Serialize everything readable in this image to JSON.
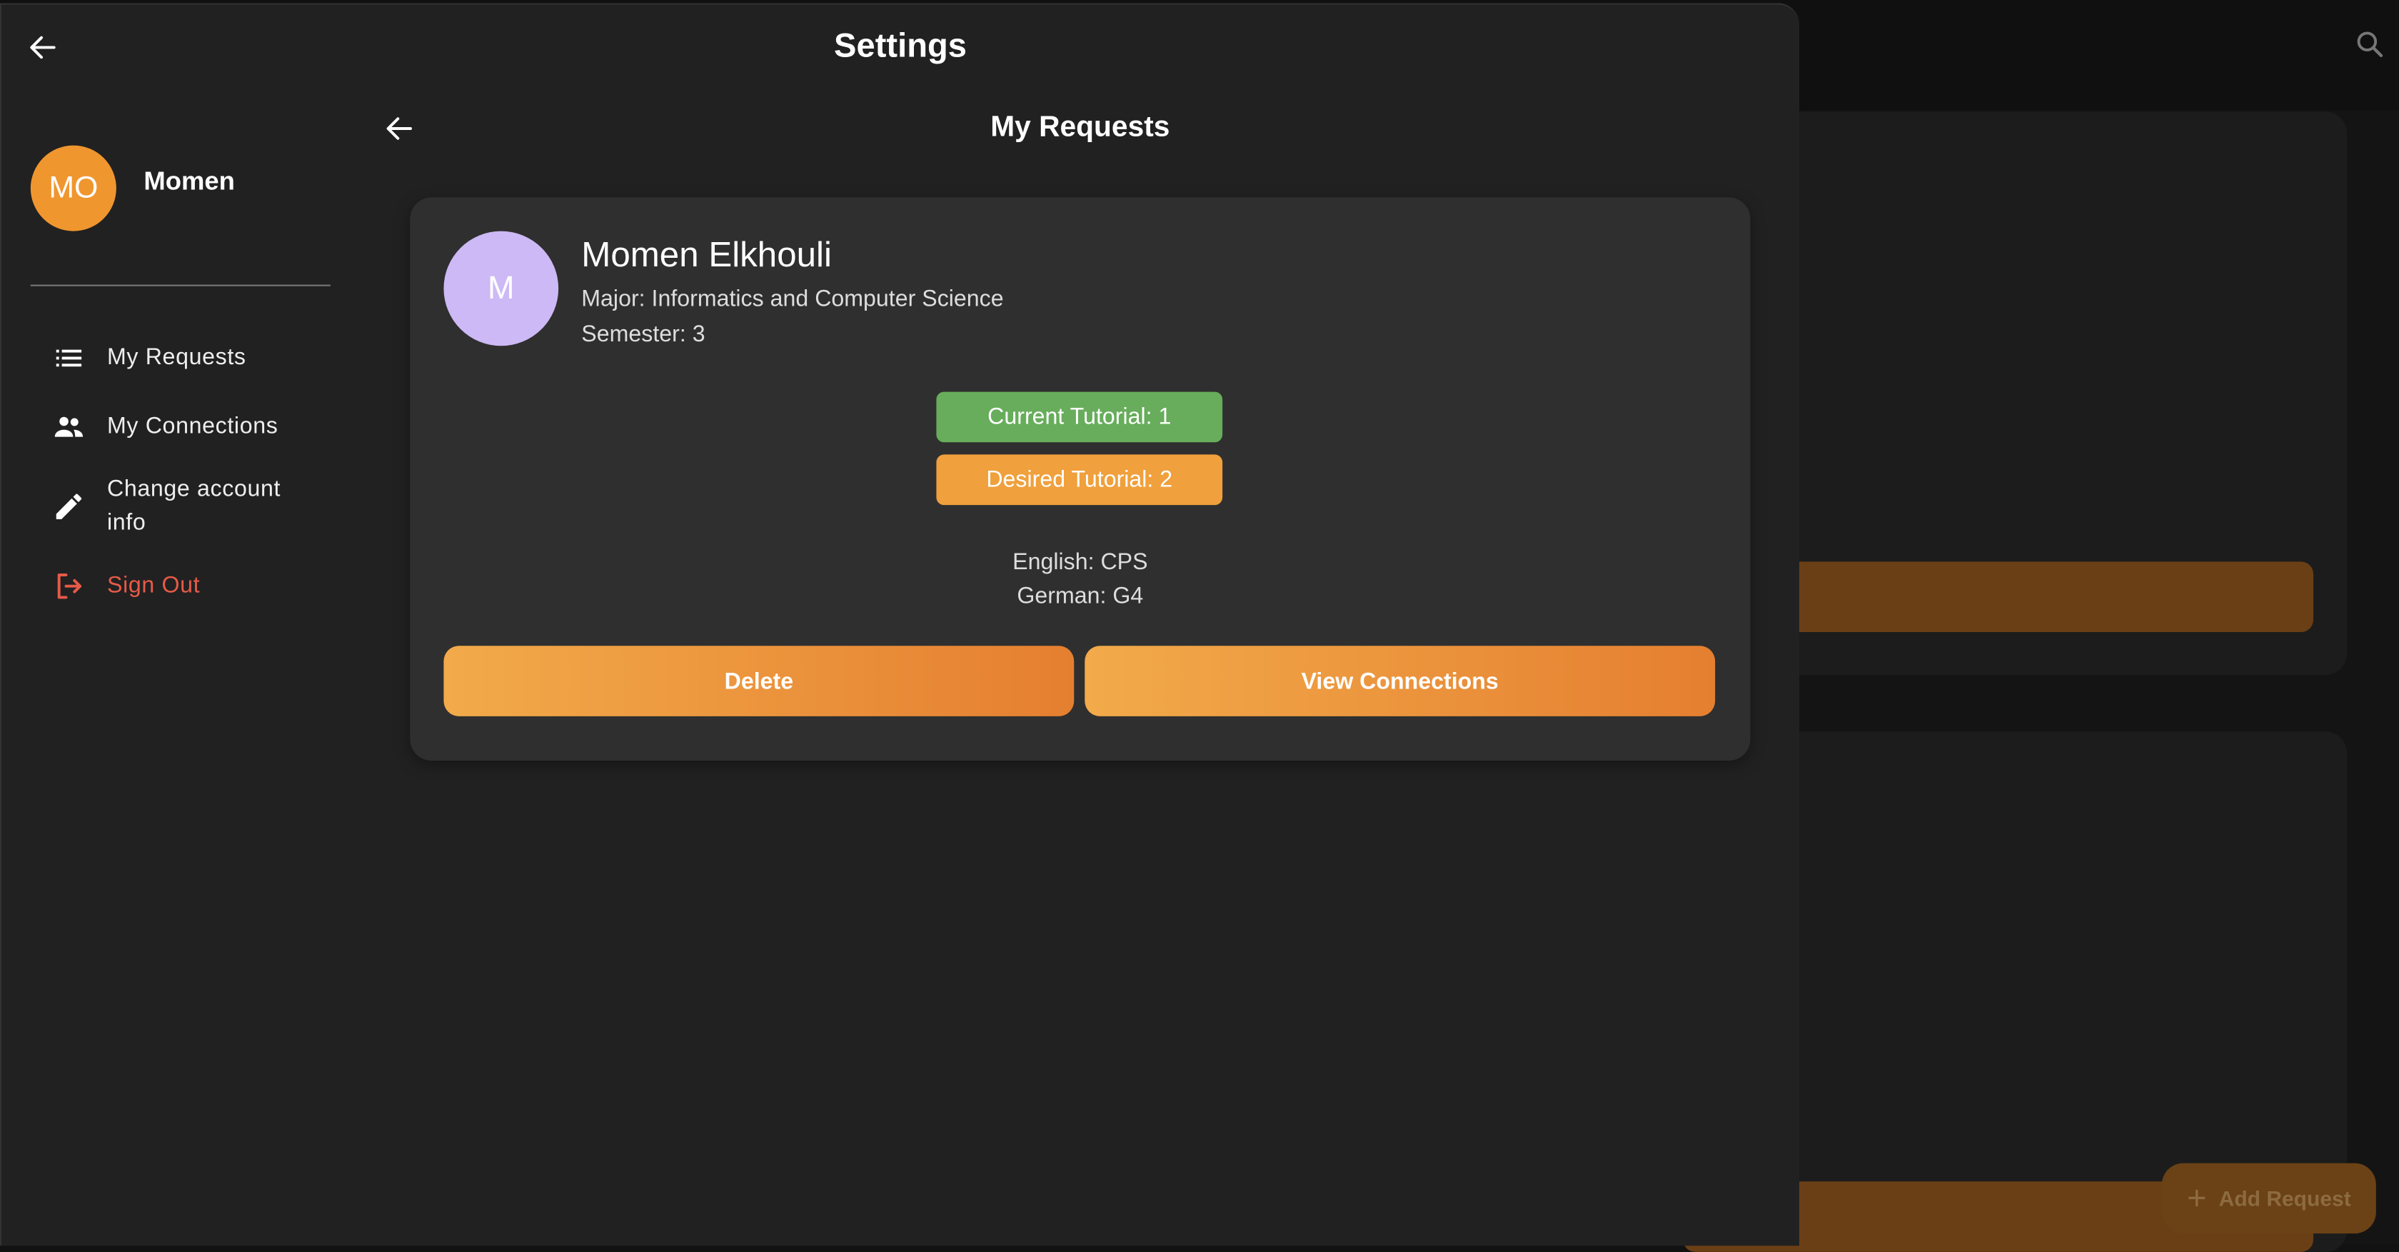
{
  "settings": {
    "title": "Settings"
  },
  "profile": {
    "initials": "MO",
    "name": "Momen"
  },
  "nav": {
    "my_requests": "My Requests",
    "my_connections": "My Connections",
    "change_account_info": "Change account info",
    "sign_out": "Sign Out"
  },
  "requests_page": {
    "title": "My Requests"
  },
  "request_card": {
    "avatar_initial": "M",
    "name": "Momen Elkhouli",
    "major": "Major: Informatics and Computer Science",
    "semester": "Semester: 3",
    "current_tutorial": "Current Tutorial: 1",
    "desired_tutorial": "Desired Tutorial: 2",
    "english": "English: CPS",
    "german": "German: G4",
    "delete_label": "Delete",
    "view_connections_label": "View Connections"
  },
  "background": {
    "fab_label": "Add Request"
  },
  "colors": {
    "accent": "#f0962f",
    "current_tag": "#67ad5b",
    "desired_tag": "#f0a03c",
    "sign_out": "#e75a48",
    "card_avatar": "#cdb9f5"
  },
  "icons": {
    "back": "arrow-left-icon",
    "search": "search-icon",
    "requests": "list-icon",
    "connections": "people-icon",
    "edit": "pencil-icon",
    "sign_out": "logout-icon",
    "add": "plus-icon"
  }
}
